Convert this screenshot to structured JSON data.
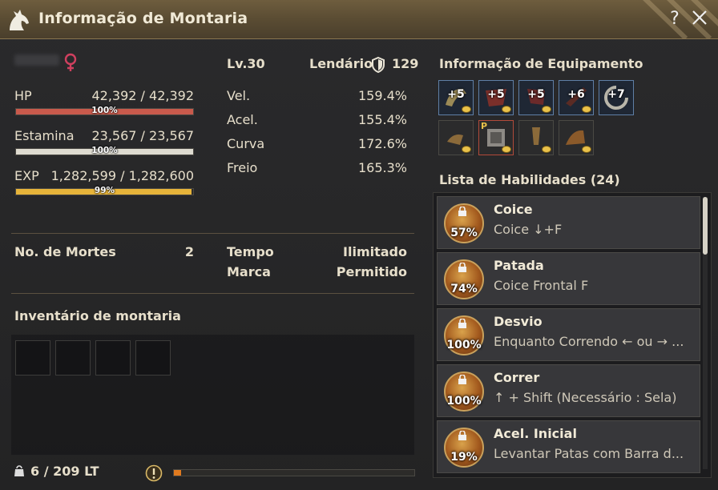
{
  "window": {
    "title": "Informação de Montaria"
  },
  "mount": {
    "level": "Lv.30",
    "grade": "Lendário",
    "armor": "129",
    "hp": {
      "label": "HP",
      "value": "42,392 / 42,392",
      "pct": "100%",
      "ratio": 1.0,
      "color": "#c95a4c"
    },
    "stamina": {
      "label": "Estamina",
      "value": "23,567 / 23,567",
      "pct": "100%",
      "ratio": 1.0,
      "color": "#dedbd0"
    },
    "exp": {
      "label": "EXP",
      "value": "1,282,599 / 1,282,600",
      "pct": "99%",
      "ratio": 0.99,
      "color": "#e7b43a"
    },
    "stats": [
      {
        "label": "Vel.",
        "value": "159.4%"
      },
      {
        "label": "Acel.",
        "value": "155.4%"
      },
      {
        "label": "Curva",
        "value": "172.6%"
      },
      {
        "label": "Freio",
        "value": "165.3%"
      }
    ],
    "deaths_label": "No. de Mortes",
    "deaths_value": "2",
    "time_label": "Tempo",
    "time_value": "Ilimitado",
    "brand_label": "Marca",
    "brand_value": "Permitido"
  },
  "inventory": {
    "title": "Inventário de montaria",
    "weight": "6 / 209 LT",
    "weight_ratio": 0.03
  },
  "equipment": {
    "title": "Informação de Equipamento",
    "row1": [
      "+5",
      "+5",
      "+5",
      "+6",
      "+7"
    ]
  },
  "skills": {
    "title": "Lista de Habilidades (24)",
    "items": [
      {
        "name": "Coice",
        "cmd": "Coice ↓+F",
        "pct": "57%"
      },
      {
        "name": "Patada",
        "cmd": "Coice Frontal F",
        "pct": "74%"
      },
      {
        "name": "Desvio",
        "cmd": "Enquanto Correndo ← ou → ...",
        "pct": "100%"
      },
      {
        "name": "Correr",
        "cmd": "↑ + Shift (Necessário : Sela)",
        "pct": "100%"
      },
      {
        "name": "Acel. Inicial",
        "cmd": "Levantar Patas com Barra d...",
        "pct": "19%"
      }
    ]
  },
  "colors": {
    "accent": "#8b7650",
    "female": "#d0405f"
  }
}
